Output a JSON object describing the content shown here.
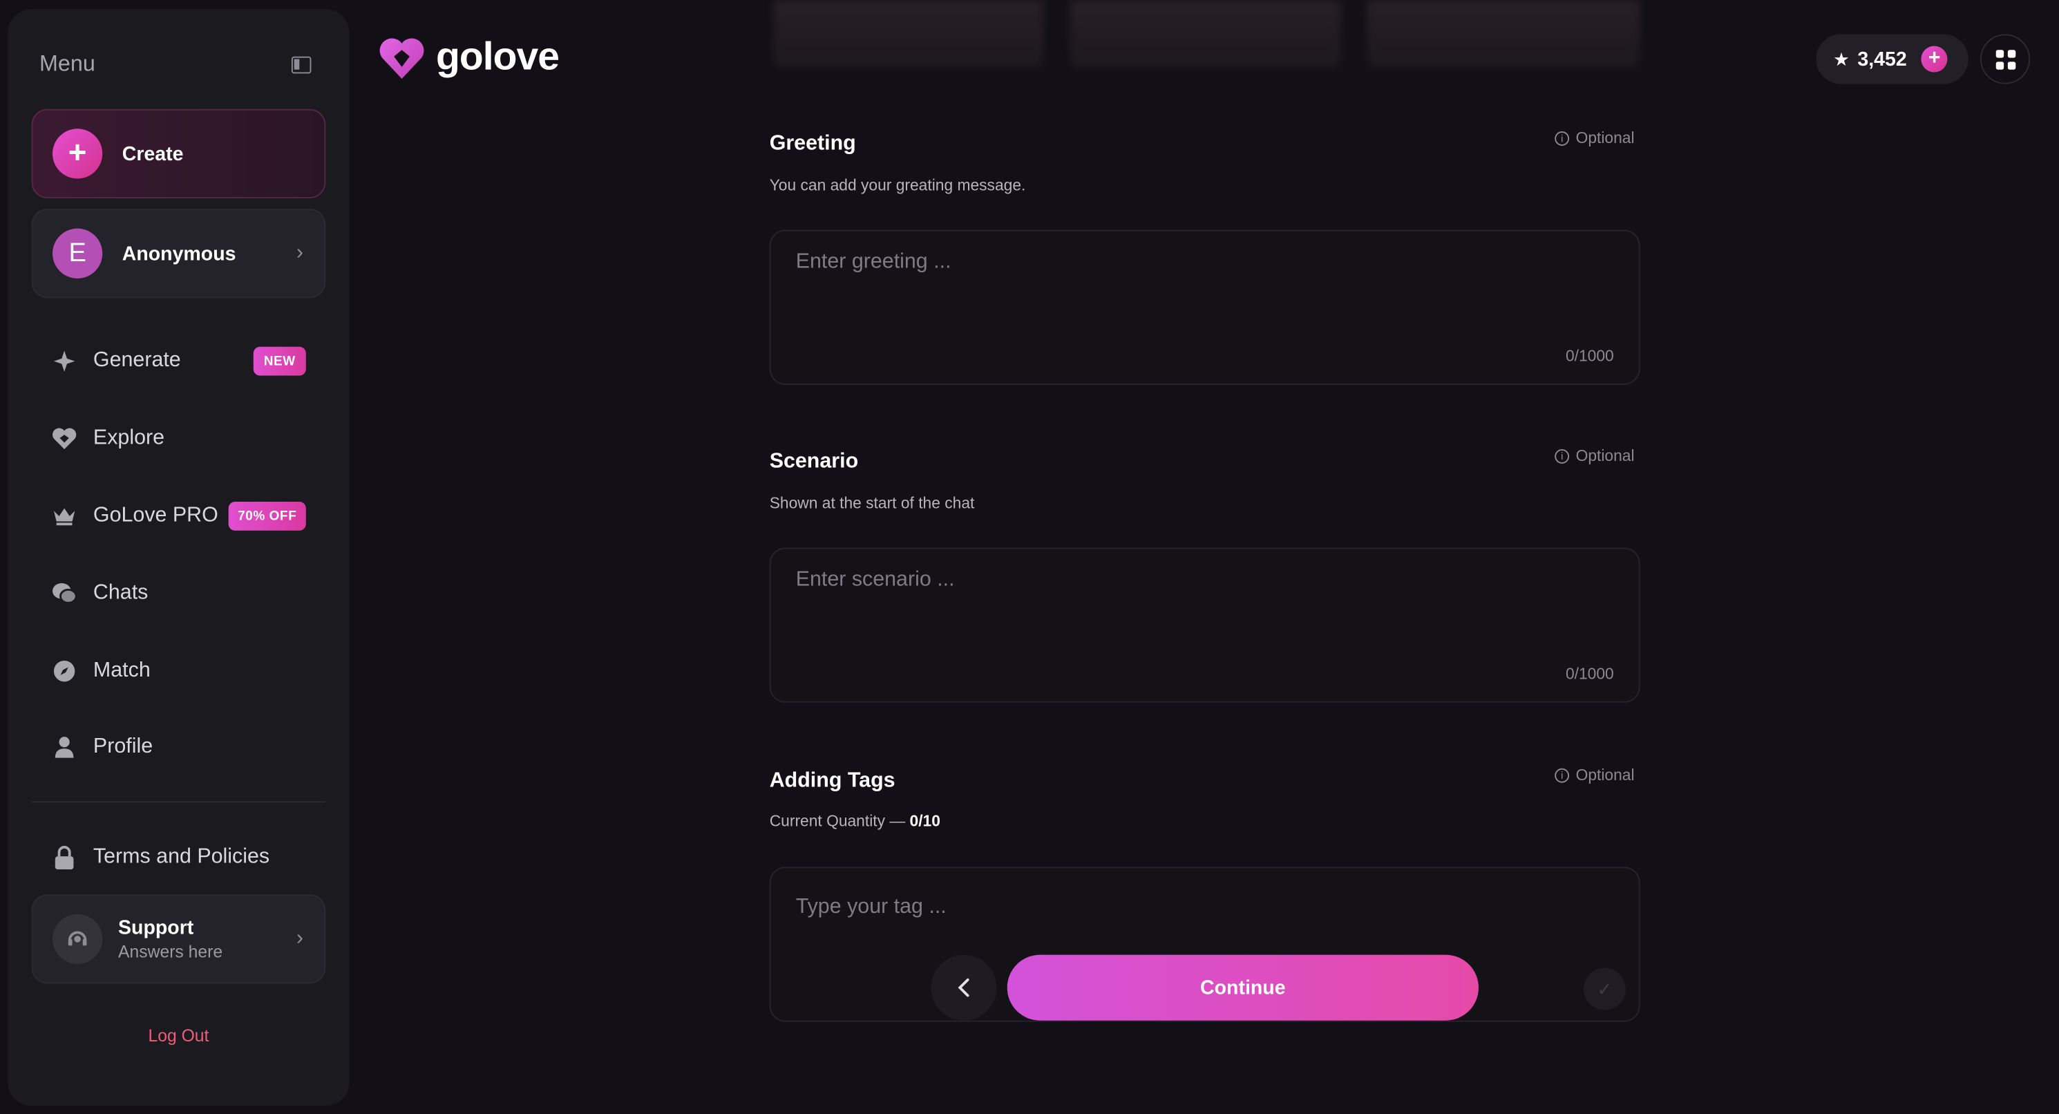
{
  "sidebar": {
    "title": "Menu",
    "create_label": "Create",
    "account": {
      "initial": "E",
      "name": "Anonymous"
    },
    "nav": [
      {
        "label": "Generate",
        "badge": "NEW"
      },
      {
        "label": "Explore"
      },
      {
        "label": "GoLove PRO",
        "badge": "70% OFF"
      },
      {
        "label": "Chats"
      },
      {
        "label": "Match"
      },
      {
        "label": "Profile"
      }
    ],
    "terms_label": "Terms and Policies",
    "support": {
      "title": "Support",
      "subtitle": "Answers here"
    },
    "logout_label": "Log Out"
  },
  "header": {
    "logo_text": "golove",
    "credits": "3,452"
  },
  "form": {
    "greeting": {
      "title": "Greeting",
      "optional": "Optional",
      "description": "You can add your greating message.",
      "placeholder": "Enter greeting ...",
      "counter": "0/1000"
    },
    "scenario": {
      "title": "Scenario",
      "optional": "Optional",
      "description": "Shown at the start of the chat",
      "placeholder": "Enter scenario ...",
      "counter": "0/1000"
    },
    "tags": {
      "title": "Adding Tags",
      "optional": "Optional",
      "quantity_label": "Current Quantity —",
      "quantity_value": "0/10",
      "placeholder": "Type your tag ..."
    },
    "continue_label": "Continue"
  },
  "colors": {
    "accent_start": "#d352da",
    "accent_end": "#e64aa8",
    "background": "#121016",
    "sidebar": "#1b1a1f",
    "logout": "#ef5d7e"
  },
  "icons": {
    "generate": "sparkle-icon",
    "explore": "heart-logo-icon",
    "pro": "crown-icon",
    "chats": "chat-bubbles-icon",
    "match": "compass-icon",
    "profile": "user-icon",
    "terms": "lock-icon",
    "support": "headset-icon"
  }
}
